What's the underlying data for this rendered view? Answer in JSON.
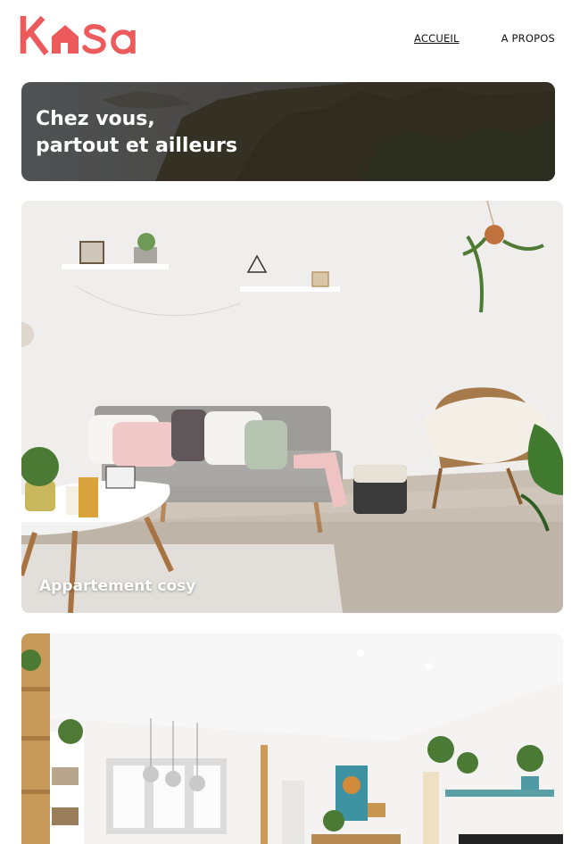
{
  "header": {
    "logo_text": "Kasa",
    "nav": [
      {
        "label": "ACCUEIL",
        "active": true
      },
      {
        "label": "A PROPOS",
        "active": false
      }
    ]
  },
  "banner": {
    "line1": "Chez vous,",
    "line2": "partout et ailleurs"
  },
  "listings": [
    {
      "title": "Appartement cosy"
    },
    {
      "title": ""
    }
  ],
  "colors": {
    "brand": "#ec5a5c",
    "text": "#111111"
  }
}
